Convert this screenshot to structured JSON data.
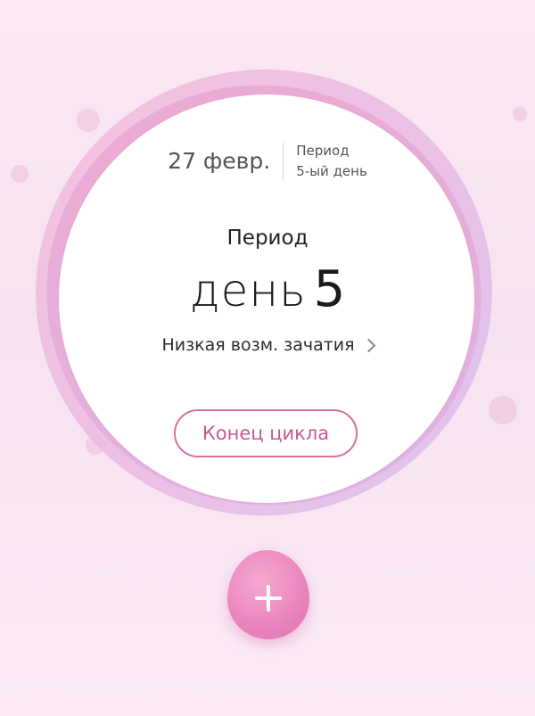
{
  "status": {
    "date": "27 февр.",
    "phase": "Период",
    "day_text": "5-ый день"
  },
  "main": {
    "period_label": "Период",
    "day_word": "день",
    "day_number": "5",
    "fertility": "Низкая возм. зачатия"
  },
  "actions": {
    "end_cycle_label": "Конец цикла",
    "add_icon": "plus-icon"
  },
  "colors": {
    "accent": "#d9719f",
    "button_fill": "#e984bd"
  }
}
